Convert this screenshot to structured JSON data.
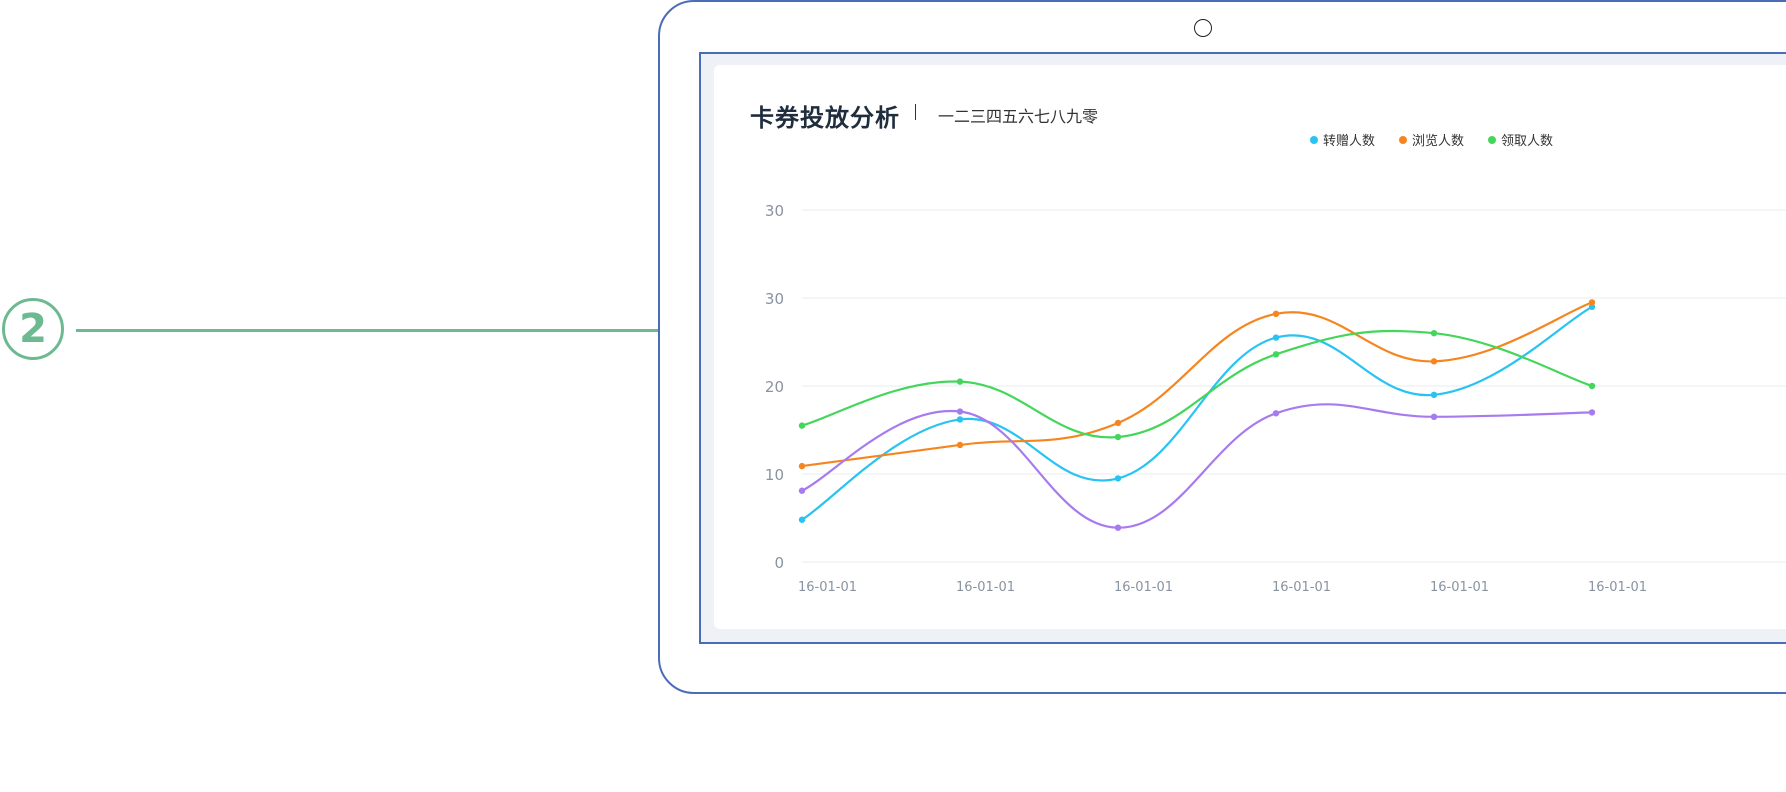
{
  "callout": {
    "number": "2"
  },
  "card": {
    "title": "卡券投放分析",
    "subtitle": "一二三四五六七八九零"
  },
  "colors": {
    "callout": "#6dba91",
    "device_border": "#4b6cb7",
    "grid": "#e8ebef",
    "tick_text": "#8a93a0"
  },
  "chart_data": {
    "type": "line",
    "title": "卡券投放分析",
    "subtitle": "一二三四五六七八九零",
    "legend_position": "top-right",
    "grid": true,
    "smooth": true,
    "ylim": [
      0,
      40
    ],
    "y_ticks": [
      0,
      10,
      20,
      30,
      40
    ],
    "y_tick_labels": [
      "0",
      "10",
      "20",
      "30",
      "30"
    ],
    "categories": [
      "16-01-01",
      "16-01-01",
      "16-01-01",
      "16-01-01",
      "16-01-01",
      "16-01-01"
    ],
    "series": [
      {
        "name": "转赠人数",
        "color": "#28c3f2",
        "values": [
          4.8,
          16.2,
          9.5,
          25.5,
          19.0,
          29.0
        ]
      },
      {
        "name": "浏览人数",
        "color": "#f5861f",
        "values": [
          10.9,
          13.3,
          15.8,
          28.2,
          22.8,
          29.5
        ]
      },
      {
        "name": "领取人数",
        "color": "#43d65a",
        "values": [
          15.5,
          20.5,
          14.2,
          23.6,
          26.0,
          20.0
        ]
      },
      {
        "name": "",
        "color": "#a77bf0",
        "values": [
          8.1,
          17.1,
          3.9,
          16.9,
          16.5,
          17.0
        ]
      }
    ]
  }
}
